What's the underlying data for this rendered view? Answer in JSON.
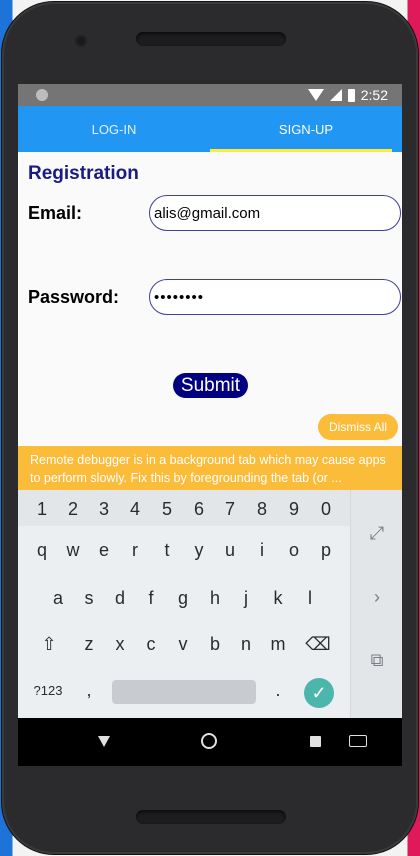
{
  "status_bar": {
    "time": "2:52"
  },
  "tabs": [
    {
      "label": "LOG-IN",
      "active": false
    },
    {
      "label": "SIGN-UP",
      "active": true
    }
  ],
  "form": {
    "title": "Registration",
    "email_label": "Email:",
    "email_value": "alis@gmail.com",
    "password_label": "Password:",
    "password_value": "••••••••",
    "submit_label": "Submit"
  },
  "banner": {
    "dismiss_label": "Dismiss All",
    "message": "Remote debugger is in a background tab which may cause apps to perform slowly. Fix this by foregrounding the tab (or ..."
  },
  "keyboard": {
    "numbers": [
      "1",
      "2",
      "3",
      "4",
      "5",
      "6",
      "7",
      "8",
      "9",
      "0"
    ],
    "row1": [
      "q",
      "w",
      "e",
      "r",
      "t",
      "y",
      "u",
      "i",
      "o",
      "p"
    ],
    "row2": [
      "a",
      "s",
      "d",
      "f",
      "g",
      "h",
      "j",
      "k",
      "l"
    ],
    "row3": [
      "z",
      "x",
      "c",
      "v",
      "b",
      "n",
      "m"
    ],
    "symbols_label": "?123",
    "comma": ",",
    "period": "."
  },
  "colors": {
    "tab_bar": "#2196f3",
    "tab_indicator": "#ffeb3b",
    "title": "#1a1a80",
    "submit": "#000080",
    "banner": "#fbbc3a",
    "enter_key": "#4db6ac"
  }
}
